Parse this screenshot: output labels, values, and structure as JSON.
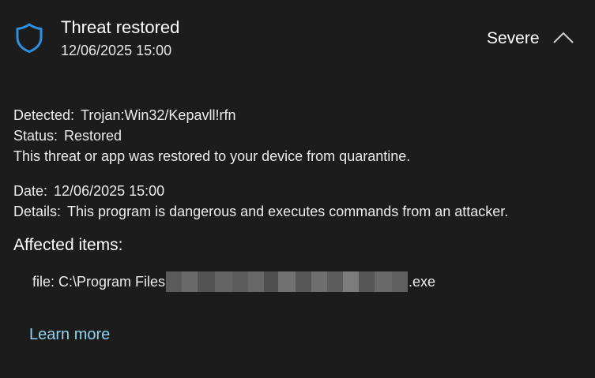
{
  "header": {
    "title": "Threat restored",
    "timestamp": "12/06/2025 15:00",
    "severity": "Severe",
    "shield_color": "#2e8fe0"
  },
  "details": {
    "detected_label": "Detected:",
    "detected_value": "Trojan:Win32/Kepavll!rfn",
    "status_label": "Status:",
    "status_value": "Restored",
    "status_description": "This threat or app was restored to your device from quarantine.",
    "date_label": "Date:",
    "date_value": "12/06/2025 15:00",
    "details_label": "Details:",
    "details_value": "This program is dangerous and executes commands from an attacker."
  },
  "affected": {
    "title": "Affected items:",
    "file_prefix": "file: C:\\Program Files",
    "file_suffix": ".exe"
  },
  "learn_more": "Learn more",
  "icons": {
    "shield": "shield-icon",
    "collapse": "chevron-up-icon"
  },
  "colors": {
    "background": "#1c1c1c",
    "link": "#8fd3f0"
  }
}
